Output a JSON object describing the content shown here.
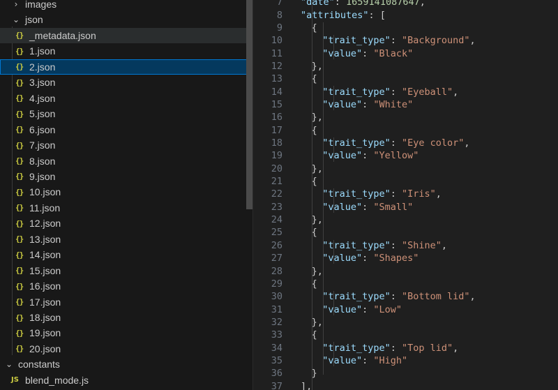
{
  "explorer": {
    "rows": [
      {
        "kind": "folder",
        "chevron": "›",
        "label": "images",
        "indent": 1
      },
      {
        "kind": "folder",
        "chevron": "⌄",
        "label": "json",
        "indent": 1
      },
      {
        "kind": "file",
        "icon": "{}",
        "label": "_metadata.json",
        "state": "hover"
      },
      {
        "kind": "file",
        "icon": "{}",
        "label": "1.json"
      },
      {
        "kind": "file",
        "icon": "{}",
        "label": "2.json",
        "state": "selected"
      },
      {
        "kind": "file",
        "icon": "{}",
        "label": "3.json"
      },
      {
        "kind": "file",
        "icon": "{}",
        "label": "4.json"
      },
      {
        "kind": "file",
        "icon": "{}",
        "label": "5.json"
      },
      {
        "kind": "file",
        "icon": "{}",
        "label": "6.json"
      },
      {
        "kind": "file",
        "icon": "{}",
        "label": "7.json"
      },
      {
        "kind": "file",
        "icon": "{}",
        "label": "8.json"
      },
      {
        "kind": "file",
        "icon": "{}",
        "label": "9.json"
      },
      {
        "kind": "file",
        "icon": "{}",
        "label": "10.json"
      },
      {
        "kind": "file",
        "icon": "{}",
        "label": "11.json"
      },
      {
        "kind": "file",
        "icon": "{}",
        "label": "12.json"
      },
      {
        "kind": "file",
        "icon": "{}",
        "label": "13.json"
      },
      {
        "kind": "file",
        "icon": "{}",
        "label": "14.json"
      },
      {
        "kind": "file",
        "icon": "{}",
        "label": "15.json"
      },
      {
        "kind": "file",
        "icon": "{}",
        "label": "16.json"
      },
      {
        "kind": "file",
        "icon": "{}",
        "label": "17.json"
      },
      {
        "kind": "file",
        "icon": "{}",
        "label": "18.json"
      },
      {
        "kind": "file",
        "icon": "{}",
        "label": "19.json"
      },
      {
        "kind": "file",
        "icon": "{}",
        "label": "20.json"
      },
      {
        "kind": "folder",
        "chevron": "⌄",
        "label": "constants",
        "indent": 0
      },
      {
        "kind": "jsfile",
        "icon": "JS",
        "label": "blend_mode.js"
      }
    ]
  },
  "editor": {
    "lines": [
      {
        "n": "7",
        "indent": 1,
        "tokens": [
          {
            "t": "key",
            "v": "\"date\""
          },
          {
            "t": "punc",
            "v": ": "
          },
          {
            "t": "num",
            "v": "1659141087647"
          },
          {
            "t": "punc",
            "v": ","
          }
        ]
      },
      {
        "n": "8",
        "indent": 1,
        "tokens": [
          {
            "t": "key",
            "v": "\"attributes\""
          },
          {
            "t": "punc",
            "v": ": ["
          }
        ]
      },
      {
        "n": "9",
        "indent": 2,
        "tokens": [
          {
            "t": "punc",
            "v": "{"
          }
        ]
      },
      {
        "n": "10",
        "indent": 3,
        "tokens": [
          {
            "t": "key",
            "v": "\"trait_type\""
          },
          {
            "t": "punc",
            "v": ": "
          },
          {
            "t": "str",
            "v": "\"Background\""
          },
          {
            "t": "punc",
            "v": ","
          }
        ]
      },
      {
        "n": "11",
        "indent": 3,
        "tokens": [
          {
            "t": "key",
            "v": "\"value\""
          },
          {
            "t": "punc",
            "v": ": "
          },
          {
            "t": "str",
            "v": "\"Black\""
          }
        ]
      },
      {
        "n": "12",
        "indent": 2,
        "tokens": [
          {
            "t": "punc",
            "v": "},"
          }
        ]
      },
      {
        "n": "13",
        "indent": 2,
        "tokens": [
          {
            "t": "punc",
            "v": "{"
          }
        ]
      },
      {
        "n": "14",
        "indent": 3,
        "tokens": [
          {
            "t": "key",
            "v": "\"trait_type\""
          },
          {
            "t": "punc",
            "v": ": "
          },
          {
            "t": "str",
            "v": "\"Eyeball\""
          },
          {
            "t": "punc",
            "v": ","
          }
        ]
      },
      {
        "n": "15",
        "indent": 3,
        "tokens": [
          {
            "t": "key",
            "v": "\"value\""
          },
          {
            "t": "punc",
            "v": ": "
          },
          {
            "t": "str",
            "v": "\"White\""
          }
        ]
      },
      {
        "n": "16",
        "indent": 2,
        "tokens": [
          {
            "t": "punc",
            "v": "},"
          }
        ]
      },
      {
        "n": "17",
        "indent": 2,
        "tokens": [
          {
            "t": "punc",
            "v": "{"
          }
        ]
      },
      {
        "n": "18",
        "indent": 3,
        "tokens": [
          {
            "t": "key",
            "v": "\"trait_type\""
          },
          {
            "t": "punc",
            "v": ": "
          },
          {
            "t": "str",
            "v": "\"Eye color\""
          },
          {
            "t": "punc",
            "v": ","
          }
        ]
      },
      {
        "n": "19",
        "indent": 3,
        "tokens": [
          {
            "t": "key",
            "v": "\"value\""
          },
          {
            "t": "punc",
            "v": ": "
          },
          {
            "t": "str",
            "v": "\"Yellow\""
          }
        ]
      },
      {
        "n": "20",
        "indent": 2,
        "tokens": [
          {
            "t": "punc",
            "v": "},"
          }
        ]
      },
      {
        "n": "21",
        "indent": 2,
        "tokens": [
          {
            "t": "punc",
            "v": "{"
          }
        ]
      },
      {
        "n": "22",
        "indent": 3,
        "tokens": [
          {
            "t": "key",
            "v": "\"trait_type\""
          },
          {
            "t": "punc",
            "v": ": "
          },
          {
            "t": "str",
            "v": "\"Iris\""
          },
          {
            "t": "punc",
            "v": ","
          }
        ]
      },
      {
        "n": "23",
        "indent": 3,
        "tokens": [
          {
            "t": "key",
            "v": "\"value\""
          },
          {
            "t": "punc",
            "v": ": "
          },
          {
            "t": "str",
            "v": "\"Small\""
          }
        ]
      },
      {
        "n": "24",
        "indent": 2,
        "tokens": [
          {
            "t": "punc",
            "v": "},"
          }
        ]
      },
      {
        "n": "25",
        "indent": 2,
        "tokens": [
          {
            "t": "punc",
            "v": "{"
          }
        ]
      },
      {
        "n": "26",
        "indent": 3,
        "tokens": [
          {
            "t": "key",
            "v": "\"trait_type\""
          },
          {
            "t": "punc",
            "v": ": "
          },
          {
            "t": "str",
            "v": "\"Shine\""
          },
          {
            "t": "punc",
            "v": ","
          }
        ]
      },
      {
        "n": "27",
        "indent": 3,
        "tokens": [
          {
            "t": "key",
            "v": "\"value\""
          },
          {
            "t": "punc",
            "v": ": "
          },
          {
            "t": "str",
            "v": "\"Shapes\""
          }
        ]
      },
      {
        "n": "28",
        "indent": 2,
        "tokens": [
          {
            "t": "punc",
            "v": "},"
          }
        ]
      },
      {
        "n": "29",
        "indent": 2,
        "tokens": [
          {
            "t": "punc",
            "v": "{"
          }
        ]
      },
      {
        "n": "30",
        "indent": 3,
        "tokens": [
          {
            "t": "key",
            "v": "\"trait_type\""
          },
          {
            "t": "punc",
            "v": ": "
          },
          {
            "t": "str",
            "v": "\"Bottom lid\""
          },
          {
            "t": "punc",
            "v": ","
          }
        ]
      },
      {
        "n": "31",
        "indent": 3,
        "tokens": [
          {
            "t": "key",
            "v": "\"value\""
          },
          {
            "t": "punc",
            "v": ": "
          },
          {
            "t": "str",
            "v": "\"Low\""
          }
        ]
      },
      {
        "n": "32",
        "indent": 2,
        "tokens": [
          {
            "t": "punc",
            "v": "},"
          }
        ]
      },
      {
        "n": "33",
        "indent": 2,
        "tokens": [
          {
            "t": "punc",
            "v": "{"
          }
        ]
      },
      {
        "n": "34",
        "indent": 3,
        "tokens": [
          {
            "t": "key",
            "v": "\"trait_type\""
          },
          {
            "t": "punc",
            "v": ": "
          },
          {
            "t": "str",
            "v": "\"Top lid\""
          },
          {
            "t": "punc",
            "v": ","
          }
        ]
      },
      {
        "n": "35",
        "indent": 3,
        "tokens": [
          {
            "t": "key",
            "v": "\"value\""
          },
          {
            "t": "punc",
            "v": ": "
          },
          {
            "t": "str",
            "v": "\"High\""
          }
        ]
      },
      {
        "n": "36",
        "indent": 2,
        "tokens": [
          {
            "t": "punc",
            "v": "}"
          }
        ]
      },
      {
        "n": "37",
        "indent": 1,
        "tokens": [
          {
            "t": "punc",
            "v": "],"
          }
        ]
      }
    ]
  },
  "colors": {
    "key": "#9cdcfe",
    "string": "#ce9178",
    "number": "#b5cea8",
    "json_icon": "#cbcb41",
    "selection": "#04395e",
    "focus_border": "#0078d4"
  }
}
